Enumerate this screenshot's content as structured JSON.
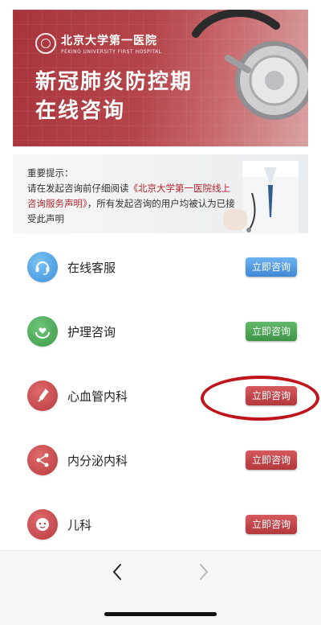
{
  "banner": {
    "logo_cn": "北京大学第一医院",
    "logo_en": "PEKING UNIVERSITY FIRST HOSPITAL",
    "title_line1": "新冠肺炎防控期",
    "title_line2": "在线咨询"
  },
  "notice": {
    "heading": "重要提示：",
    "line1_prefix": "请在发起咨询前仔细阅读",
    "link_text": "《北京大学第一医院线上咨询服务声明》",
    "line2_suffix": "，所有发起咨询的用户均被认为已接受此声明"
  },
  "services": [
    {
      "label": "在线客服",
      "button": "立即咨询",
      "icon": "headset-icon",
      "color": "#4a96dd"
    },
    {
      "label": "护理咨询",
      "button": "立即咨询",
      "icon": "care-hands-icon",
      "color": "#4aa356"
    },
    {
      "label": "心血管内科",
      "button": "立即咨询",
      "icon": "syringe-icon",
      "color": "#c04145"
    },
    {
      "label": "内分泌内科",
      "button": "立即咨询",
      "icon": "network-icon",
      "color": "#c04145"
    },
    {
      "label": "儿科",
      "button": "立即咨询",
      "icon": "baby-icon",
      "color": "#c04145"
    }
  ],
  "nav": {
    "back": "back-chevron-icon",
    "forward": "forward-chevron-icon"
  }
}
